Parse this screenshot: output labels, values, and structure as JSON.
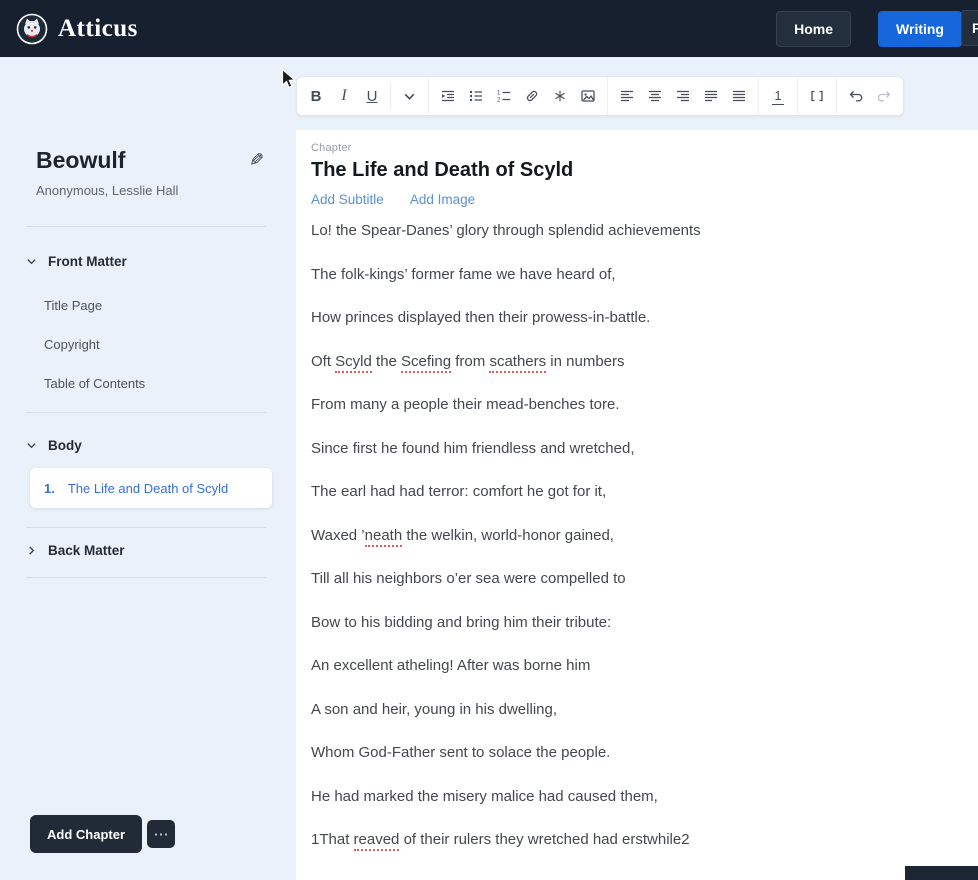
{
  "navbar": {
    "brand": "Atticus",
    "buttons": {
      "home": "Home",
      "writing": "Writing",
      "partial": "F"
    }
  },
  "sidebar": {
    "book_title": "Beowulf",
    "book_author": "Anonymous, Lesslie Hall",
    "sections": [
      {
        "label": "Front Matter",
        "expanded": true,
        "items": [
          "Title Page",
          "Copyright",
          "Table of Contents"
        ]
      },
      {
        "label": "Body",
        "expanded": true,
        "items": [
          {
            "number": "1.",
            "label": "The Life and Death of Scyld",
            "active": true
          }
        ]
      },
      {
        "label": "Back Matter",
        "expanded": false,
        "items": []
      }
    ],
    "add_chapter_label": "Add Chapter",
    "more_button_label": "⋯"
  },
  "toolbar": {
    "bold": "B",
    "italic": "I",
    "underline": "U",
    "page_number": "1",
    "icon_names": [
      "bold",
      "italic",
      "underline",
      "text-style-dropdown",
      "indent",
      "bullet-list",
      "ordered-list",
      "link",
      "footnote",
      "image",
      "align-left",
      "align-center",
      "align-right",
      "align-justify-left",
      "align-justify",
      "page-number",
      "page-break",
      "undo",
      "redo"
    ]
  },
  "editor": {
    "chapter_label": "Chapter",
    "title": "The Life and Death of Scyld",
    "add_subtitle": "Add Subtitle",
    "add_image": "Add Image",
    "paragraphs": [
      [
        {
          "t": "Lo! the Spear-Danes’ glory through splendid achievements"
        }
      ],
      [
        {
          "t": "The folk-kings’ former fame we have heard of,"
        }
      ],
      [
        {
          "t": "How princes displayed then their prowess-in-battle."
        }
      ],
      [
        {
          "t": "Oft "
        },
        {
          "t": "Scyld",
          "sp": true
        },
        {
          "t": " the "
        },
        {
          "t": "Scefing",
          "sp": true
        },
        {
          "t": " from "
        },
        {
          "t": "scathers",
          "sp": true
        },
        {
          "t": " in numbers"
        }
      ],
      [
        {
          "t": "From many a people their mead-benches tore."
        }
      ],
      [
        {
          "t": "Since first he found him friendless and wretched,"
        }
      ],
      [
        {
          "t": "The earl had had terror: comfort he got for it,"
        }
      ],
      [
        {
          "t": "Waxed ’"
        },
        {
          "t": "neath",
          "sp": true
        },
        {
          "t": " the welkin, world-honor gained,"
        }
      ],
      [
        {
          "t": "Till all his neighbors o’er sea were compelled to"
        }
      ],
      [
        {
          "t": "Bow to his bidding and bring him their tribute:"
        }
      ],
      [
        {
          "t": "An excellent atheling! After was borne him"
        }
      ],
      [
        {
          "t": "A son and heir, young in his dwelling,"
        }
      ],
      [
        {
          "t": "Whom God-Father sent to solace the people."
        }
      ],
      [
        {
          "t": "He had marked the misery malice had caused them,"
        }
      ],
      [
        {
          "t": "1That "
        },
        {
          "t": "reaved",
          "sp": true
        },
        {
          "t": " of their rulers they wretched had erstwhile2"
        }
      ]
    ]
  },
  "colors": {
    "navbar_bg": "#16202e",
    "accent_blue": "#1667db",
    "link_blue": "#5a91d8",
    "active_chapter_blue": "#3470d4",
    "misspell_red": "#dd5c5c",
    "page_bg": "#e9f1fa",
    "dark_button": "#212b38"
  }
}
